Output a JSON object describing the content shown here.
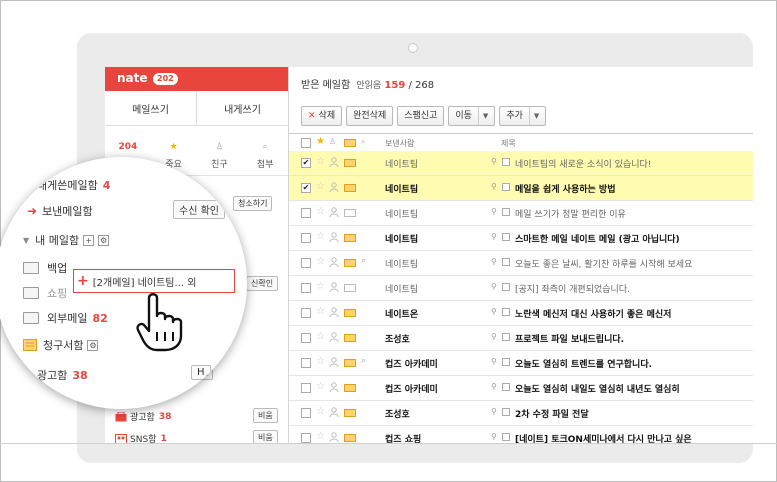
{
  "sidebar": {
    "logo": "nate",
    "logo_count": "202",
    "compose": {
      "write_mail": "메일쓰기",
      "write_self": "내게쓰기"
    },
    "quick": [
      {
        "top": "204",
        "label": ""
      },
      {
        "top": "★",
        "label": "중요"
      },
      {
        "top": "♙",
        "label": "친구"
      },
      {
        "top": "⌕",
        "label": "첨부"
      }
    ],
    "empty_btn": "청소하기",
    "confirm_btn": "신확인",
    "h_btn": "H",
    "bottom": [
      {
        "label": "광고함",
        "count": "38",
        "btn": "비움"
      },
      {
        "label": "SNS함",
        "count": "1",
        "btn": "비움"
      }
    ]
  },
  "main": {
    "title": "받은 메일함",
    "unread_label": "안읽음",
    "unread": "159",
    "total": "/ 268",
    "toolbar": {
      "delete": "삭제",
      "perm_delete": "완전삭제",
      "spam": "스팸신고",
      "move": "이동",
      "more": "추가"
    },
    "columns": {
      "sender": "보낸사람",
      "subject": "제목"
    },
    "rows": [
      {
        "checked": true,
        "selected": true,
        "unread": false,
        "open": false,
        "clip": false,
        "sender": "네이트팀",
        "subject": "네이트팀의 새로운 소식이 있습니다!"
      },
      {
        "checked": true,
        "selected": true,
        "unread": true,
        "open": false,
        "clip": false,
        "sender": "네이트팀",
        "subject": "메일을 쉽게 사용하는 방법"
      },
      {
        "checked": false,
        "selected": false,
        "unread": false,
        "open": true,
        "clip": false,
        "sender": "네이트팀",
        "subject": "메일 쓰기가 정말 편리한 이유"
      },
      {
        "checked": false,
        "selected": false,
        "unread": true,
        "open": false,
        "clip": false,
        "sender": "네이트팀",
        "subject": "스마트한 메일 네이트 메일 (광고 아닙니다)"
      },
      {
        "checked": false,
        "selected": false,
        "unread": false,
        "open": false,
        "clip": true,
        "sender": "네이트팀",
        "subject": "오늘도 좋은 날씨, 활기찬 하루를 시작해 보세요"
      },
      {
        "checked": false,
        "selected": false,
        "unread": false,
        "open": true,
        "clip": false,
        "sender": "네이트팀",
        "subject": "[공지] 좌측이 개편되었습니다."
      },
      {
        "checked": false,
        "selected": false,
        "unread": true,
        "open": false,
        "clip": false,
        "sender": "네이트온",
        "subject": "노란색 메신저 대신 사용하기 좋은 메신저"
      },
      {
        "checked": false,
        "selected": false,
        "unread": true,
        "open": false,
        "clip": false,
        "sender": "조성호",
        "subject": "프로젝트 파일 보내드립니다."
      },
      {
        "checked": false,
        "selected": false,
        "unread": true,
        "open": false,
        "clip": true,
        "sender": "컵즈 아카데미",
        "subject": "오늘도 열심히 트렌드를 연구합니다."
      },
      {
        "checked": false,
        "selected": false,
        "unread": true,
        "open": false,
        "clip": false,
        "sender": "컵즈 아카데미",
        "subject": "오늘도 열심히 내일도 열심히 내년도 열심히"
      },
      {
        "checked": false,
        "selected": false,
        "unread": true,
        "open": false,
        "clip": false,
        "sender": "조성호",
        "subject": "2차 수정 파일 전달"
      },
      {
        "checked": false,
        "selected": false,
        "unread": true,
        "open": false,
        "clip": false,
        "sender": "컵즈 쇼핑",
        "subject": "[네이트] 토크ON세미나에서 다시 만나고 싶은"
      }
    ]
  },
  "zoom": {
    "sent_self": {
      "label": "내게쓴메일함",
      "count": "4"
    },
    "sent": {
      "label": "보낸메일함",
      "btn": "수신 확인"
    },
    "my_mailbox": "내 메일함",
    "backup": "백업",
    "shop_partial": "쇼핑",
    "outer": {
      "label": "외부메일",
      "count": "82"
    },
    "billing": "청구서함",
    "ad": {
      "label": "광고함",
      "count": "38"
    },
    "h_btn": "H",
    "drag_text": "[2개메일] 네이트팀... 외"
  },
  "colors": {
    "brand": "#e8453c",
    "selected_row": "#fffbb0"
  }
}
